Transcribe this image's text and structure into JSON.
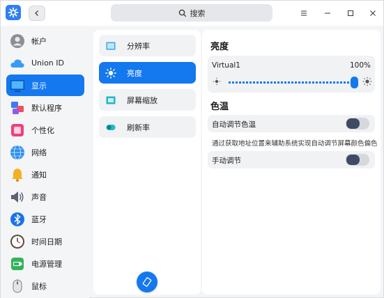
{
  "titlebar": {
    "search_label": "搜索"
  },
  "sidebar": {
    "items": [
      {
        "label": "帐户",
        "icon": "account-icon",
        "active": false
      },
      {
        "label": "Union ID",
        "icon": "cloud-icon",
        "active": false
      },
      {
        "label": "显示",
        "icon": "display-icon",
        "active": true
      },
      {
        "label": "默认程序",
        "icon": "default-apps-icon",
        "active": false
      },
      {
        "label": "个性化",
        "icon": "personalization-icon",
        "active": false
      },
      {
        "label": "网络",
        "icon": "network-icon",
        "active": false
      },
      {
        "label": "通知",
        "icon": "bell-icon",
        "active": false
      },
      {
        "label": "声音",
        "icon": "speaker-icon",
        "active": false
      },
      {
        "label": "蓝牙",
        "icon": "bluetooth-icon",
        "active": false
      },
      {
        "label": "时间日期",
        "icon": "clock-icon",
        "active": false
      },
      {
        "label": "电源管理",
        "icon": "battery-icon",
        "active": false
      },
      {
        "label": "鼠标",
        "icon": "mouse-icon",
        "active": false
      }
    ]
  },
  "subnav": {
    "items": [
      {
        "label": "分辨率",
        "icon": "resolution-icon",
        "active": false
      },
      {
        "label": "亮度",
        "icon": "brightness-icon",
        "active": true
      },
      {
        "label": "屏幕缩放",
        "icon": "scale-icon",
        "active": false
      },
      {
        "label": "刷新率",
        "icon": "refresh-rate-icon",
        "active": false
      }
    ]
  },
  "brightness": {
    "section_title": "亮度",
    "monitor_name": "Virtual1",
    "value_text": "100%",
    "value_fraction": 1.0
  },
  "color_temp": {
    "section_title": "色温",
    "auto_label": "自动调节色温",
    "auto_enabled": false,
    "description": "通过获取地址位置来辅助系统实现自动调节屏幕颜色偏色",
    "manual_label": "手动调节",
    "manual_enabled": false
  },
  "colors": {
    "accent": "#1478ef",
    "toggle_knob": "#3f4a63"
  }
}
